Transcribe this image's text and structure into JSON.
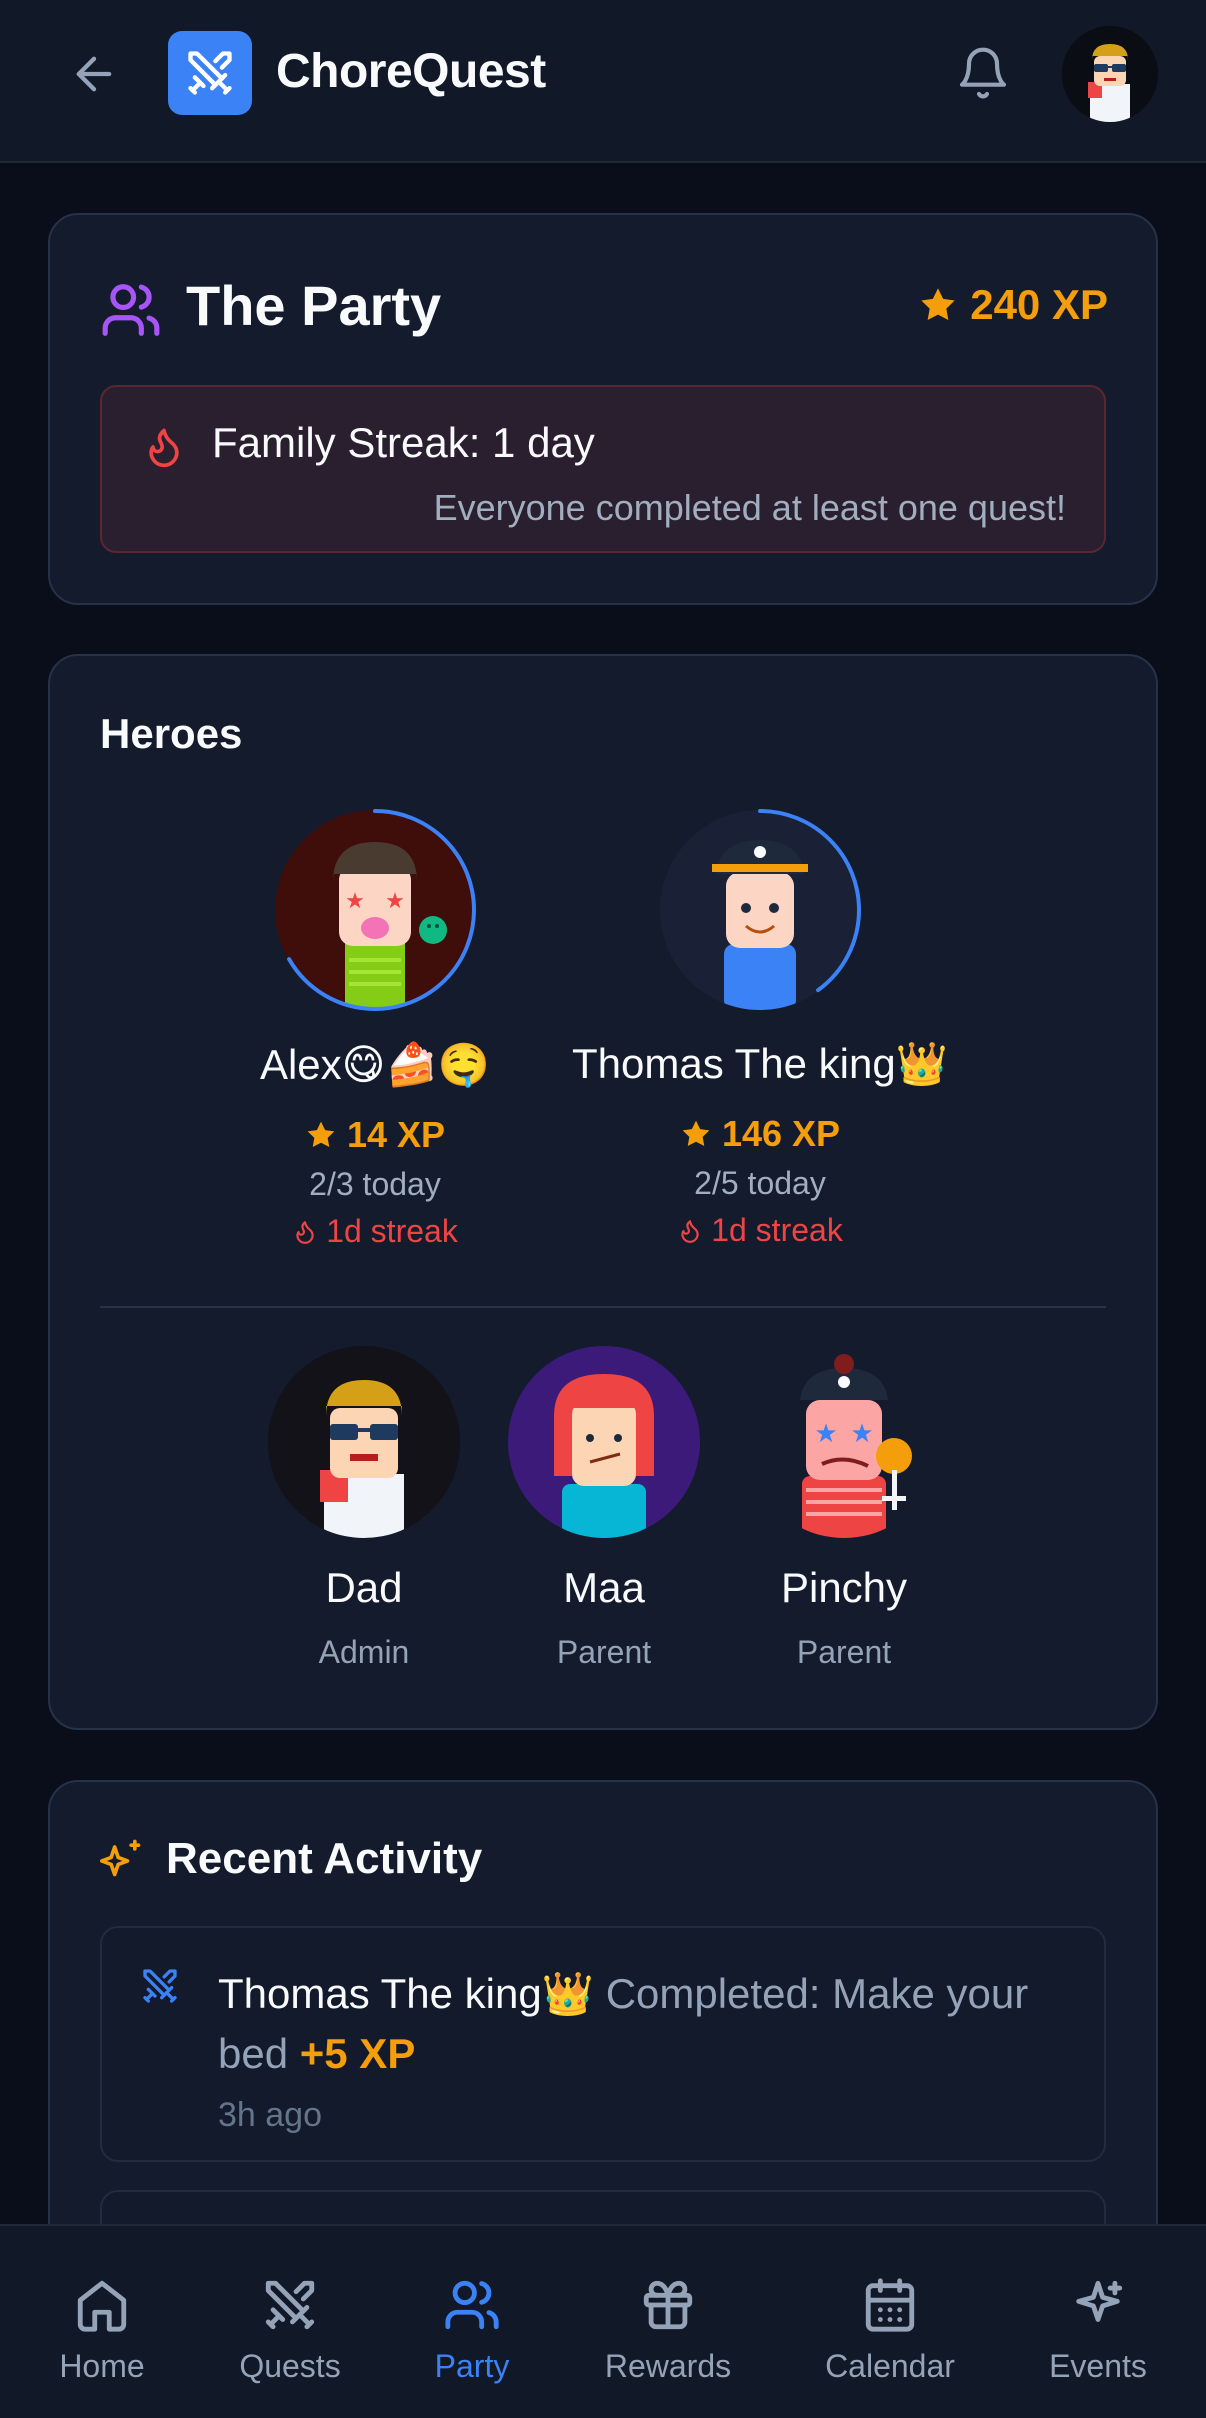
{
  "header": {
    "title": "ChoreQuest",
    "back_icon": "arrow-left-icon",
    "logo_icon": "crossed-swords-icon",
    "bell_icon": "bell-icon"
  },
  "party": {
    "title": "The Party",
    "xp": "240 XP",
    "streak_title": "Family Streak: 1 day",
    "streak_sub": "Everyone completed at least one quest!"
  },
  "heroes": {
    "title": "Heroes",
    "kids": [
      {
        "name": "Alex😋🍰🤤",
        "xp": "14 XP",
        "today": "2/3 today",
        "streak": "1d streak",
        "progress": 0.667
      },
      {
        "name": "Thomas The king👑",
        "xp": "146 XP",
        "today": "2/5 today",
        "streak": "1d streak",
        "progress": 0.4
      }
    ],
    "parents": [
      {
        "name": "Dad",
        "role": "Admin"
      },
      {
        "name": "Maa",
        "role": "Parent"
      },
      {
        "name": "Pinchy",
        "role": "Parent"
      }
    ]
  },
  "activity": {
    "title": "Recent Activity",
    "items": [
      {
        "who": "Thomas The king👑",
        "action": "Completed: Make your bed",
        "xp": "+5 XP",
        "time": "3h ago"
      }
    ]
  },
  "nav": {
    "items": [
      {
        "label": "Home"
      },
      {
        "label": "Quests"
      },
      {
        "label": "Party"
      },
      {
        "label": "Rewards"
      },
      {
        "label": "Calendar"
      },
      {
        "label": "Events"
      }
    ],
    "active": "Party"
  },
  "colors": {
    "accent": "#3b82f6",
    "xp": "#f59e0b",
    "streak": "#ef4444",
    "party_icon": "#a855f7"
  }
}
